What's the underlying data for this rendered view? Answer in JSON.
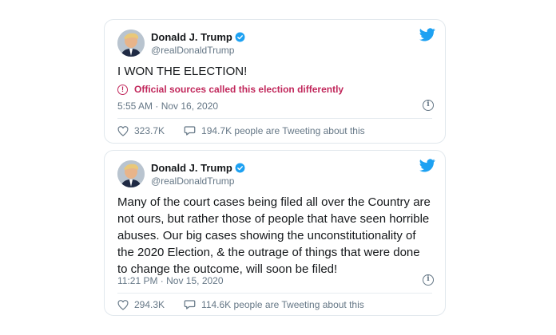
{
  "tweets": [
    {
      "name": "Donald J. Trump",
      "handle": "@realDonaldTrump",
      "text": "I WON THE ELECTION!",
      "notice": "Official sources called this election differently",
      "timestamp": "5:55 AM · Nov 16, 2020",
      "likes": "323.7K",
      "talking": "194.7K people are Tweeting about this"
    },
    {
      "name": "Donald J. Trump",
      "handle": "@realDonaldTrump",
      "text": "Many of the court cases being filed all over the Country are not ours, but rather those of people that have seen horrible abuses. Our big cases showing the unconstitutionality of the 2020 Election, & the outrage of things that were done to change the outcome, will soon be filed!",
      "timestamp": "11:21 PM · Nov 15, 2020",
      "likes": "294.3K",
      "talking": "114.6K people are Tweeting about this"
    }
  ],
  "colors": {
    "twitter_blue": "#1da1f2",
    "notice_red": "#c1275b",
    "secondary_text": "#657786",
    "border": "#e1e8ed"
  },
  "icons": {
    "brand": "twitter-bird-icon",
    "verified": "verified-badge-icon",
    "notice": "alert-circle-icon",
    "info": "info-icon",
    "like": "heart-icon",
    "talking": "speech-bubble-icon"
  }
}
